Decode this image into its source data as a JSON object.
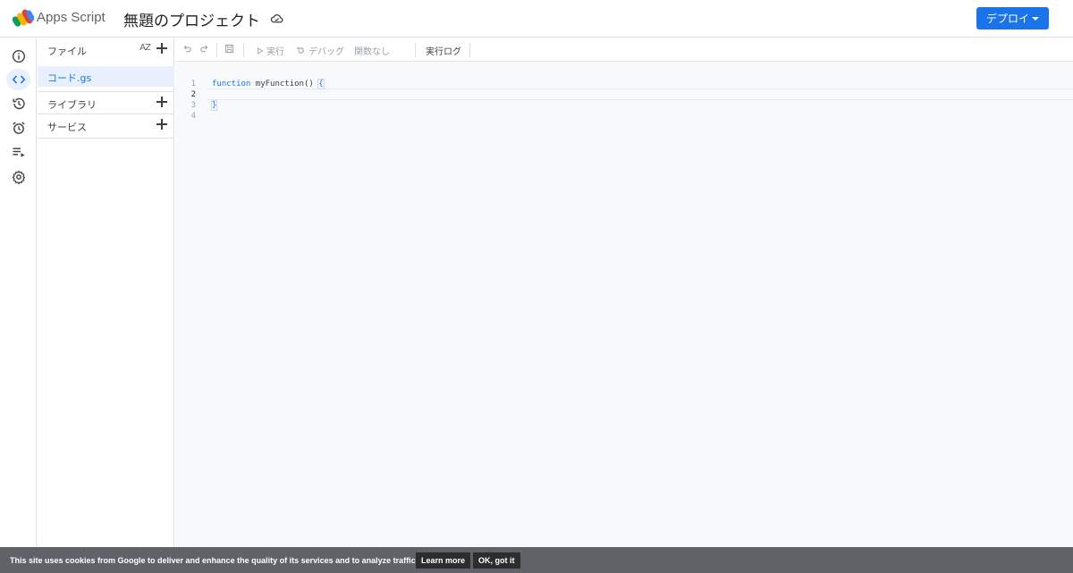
{
  "header": {
    "app_name": "Apps Script",
    "project_title": "無題のプロジェクト",
    "deploy_label": "デプロイ"
  },
  "rail": {
    "items": [
      {
        "icon": "info-icon",
        "label": "概要"
      },
      {
        "icon": "code-icon",
        "label": "エディタ",
        "active": true
      },
      {
        "icon": "history-icon",
        "label": "履歴"
      },
      {
        "icon": "alarm-icon",
        "label": "トリガー"
      },
      {
        "icon": "executions-icon",
        "label": "実行数"
      },
      {
        "icon": "gear-icon",
        "label": "設定"
      }
    ]
  },
  "files_panel": {
    "files_label": "ファイル",
    "sort_label": "AZ",
    "files": [
      "コード.gs"
    ],
    "libraries_label": "ライブラリ",
    "services_label": "サービス"
  },
  "toolbar": {
    "run_label": "実行",
    "debug_label": "デバッグ",
    "function_select": "関数なし",
    "log_label": "実行ログ"
  },
  "editor": {
    "line_numbers": [
      "1",
      "2",
      "3",
      "4"
    ],
    "line1_keyword": "function",
    "line1_rest": " myFunction() ",
    "line1_brace": "{",
    "line3_brace": "}"
  },
  "cookie_bar": {
    "text": "This site uses cookies from Google to deliver and enhance the quality of its services and to analyze traffic.",
    "learn_more": "Learn more",
    "ok": "OK, got it"
  },
  "colors": {
    "accent": "#1a73e8",
    "active_bg": "#e8f0fe",
    "cookie_bg": "#5f6368"
  }
}
